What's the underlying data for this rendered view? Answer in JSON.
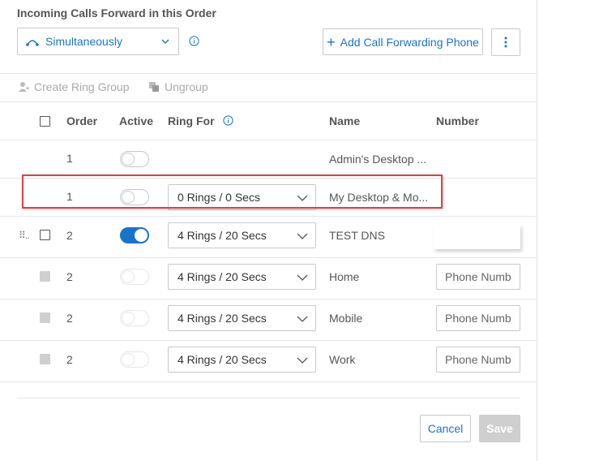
{
  "header": {
    "title": "Incoming Calls Forward in this Order",
    "mode_select": {
      "value": "Simultaneously",
      "icon": "simultaneous-ring-icon"
    },
    "add_button_label": "Add Call Forwarding Phone",
    "more_icon": "more-vertical-icon"
  },
  "toolbar": {
    "create_ring_group": "Create Ring Group",
    "ungroup": "Ungroup"
  },
  "table": {
    "columns": {
      "order": "Order",
      "active": "Active",
      "ring_for": "Ring For",
      "name": "Name",
      "number": "Number"
    },
    "rows": [
      {
        "order": "1",
        "active": false,
        "ring_for": "",
        "name": "Admin's Desktop ...",
        "number": ""
      },
      {
        "order": "1",
        "active": false,
        "ring_for": "0 Rings / 0 Secs",
        "name": "My Desktop & Mo...",
        "number": ""
      },
      {
        "order": "2",
        "active": true,
        "ring_for": "4 Rings / 20 Secs",
        "name": "TEST DNS",
        "number": ""
      },
      {
        "order": "2",
        "active": false,
        "ring_for": "4 Rings / 20 Secs",
        "name": "Home",
        "number_placeholder": "Phone Number"
      },
      {
        "order": "2",
        "active": false,
        "ring_for": "4 Rings / 20 Secs",
        "name": "Mobile",
        "number_placeholder": "Phone Number"
      },
      {
        "order": "2",
        "active": false,
        "ring_for": "4 Rings / 20 Secs",
        "name": "Work",
        "number_placeholder": "Phone Number"
      }
    ]
  },
  "footer": {
    "cancel": "Cancel",
    "save": "Save"
  },
  "colors": {
    "accent": "#1a73c9",
    "highlight": "#d64545",
    "disabled": "#cfcfcf"
  }
}
